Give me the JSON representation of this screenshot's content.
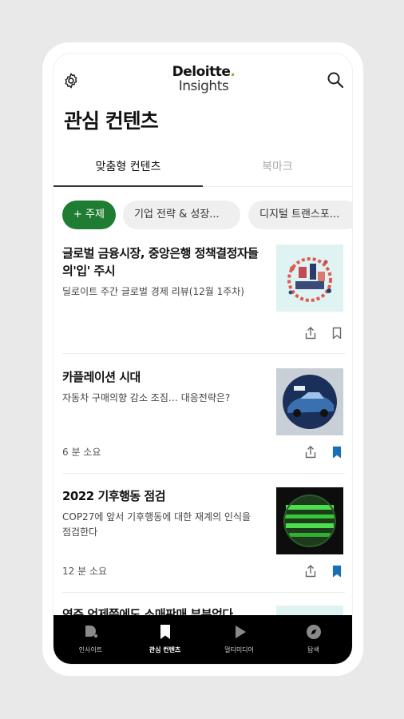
{
  "header": {
    "logo_top": "Deloitte",
    "logo_dot": ".",
    "logo_bottom": "Insights",
    "settings_icon": "gear-icon",
    "search_icon": "search-icon"
  },
  "page": {
    "title": "관심 컨텐츠"
  },
  "tabs": [
    {
      "label": "맞춤형 컨텐츠",
      "active": true
    },
    {
      "label": "북마크",
      "active": false
    }
  ],
  "chips": [
    {
      "label": "+ 주제",
      "accent": "#1e7d33"
    },
    {
      "label": "기업 전략 & 성장..."
    },
    {
      "label": "디지털 트랜스포..."
    }
  ],
  "articles": [
    {
      "title": "글로벌 금융시장, 중앙은행 정책결정자들의'입' 주시",
      "subtitle": "딜로이트 주간 글로벌 경제 리뷰(12월 1주차)",
      "time": "",
      "bookmarked": false
    },
    {
      "title": "카플레이션 시대",
      "subtitle": "자동차 구매의향 감소 조짐… 대응전략은?",
      "time": "6 분 소요",
      "bookmarked": true
    },
    {
      "title": "2022 기후행동 점검",
      "subtitle": "COP27에 앞서 기후행동에 대한 재계의 인식을 점검한다",
      "time": "12 분 소요",
      "bookmarked": true
    },
    {
      "title": "연준 언제쯤에도 소매판매 부분없다",
      "subtitle": "",
      "time": "",
      "bookmarked": false
    }
  ],
  "bottom_nav": [
    {
      "label": "인사이트",
      "icon": "deloitte-d-icon",
      "active": false
    },
    {
      "label": "관심 컨텐츠",
      "icon": "bookmark-icon",
      "active": true
    },
    {
      "label": "멀티미디어",
      "icon": "play-icon",
      "active": false
    },
    {
      "label": "탐색",
      "icon": "compass-icon",
      "active": false
    }
  ],
  "colors": {
    "accent_green": "#1e7d33",
    "bookmark_blue": "#1a6fb5",
    "logo_green": "#86bc25"
  }
}
